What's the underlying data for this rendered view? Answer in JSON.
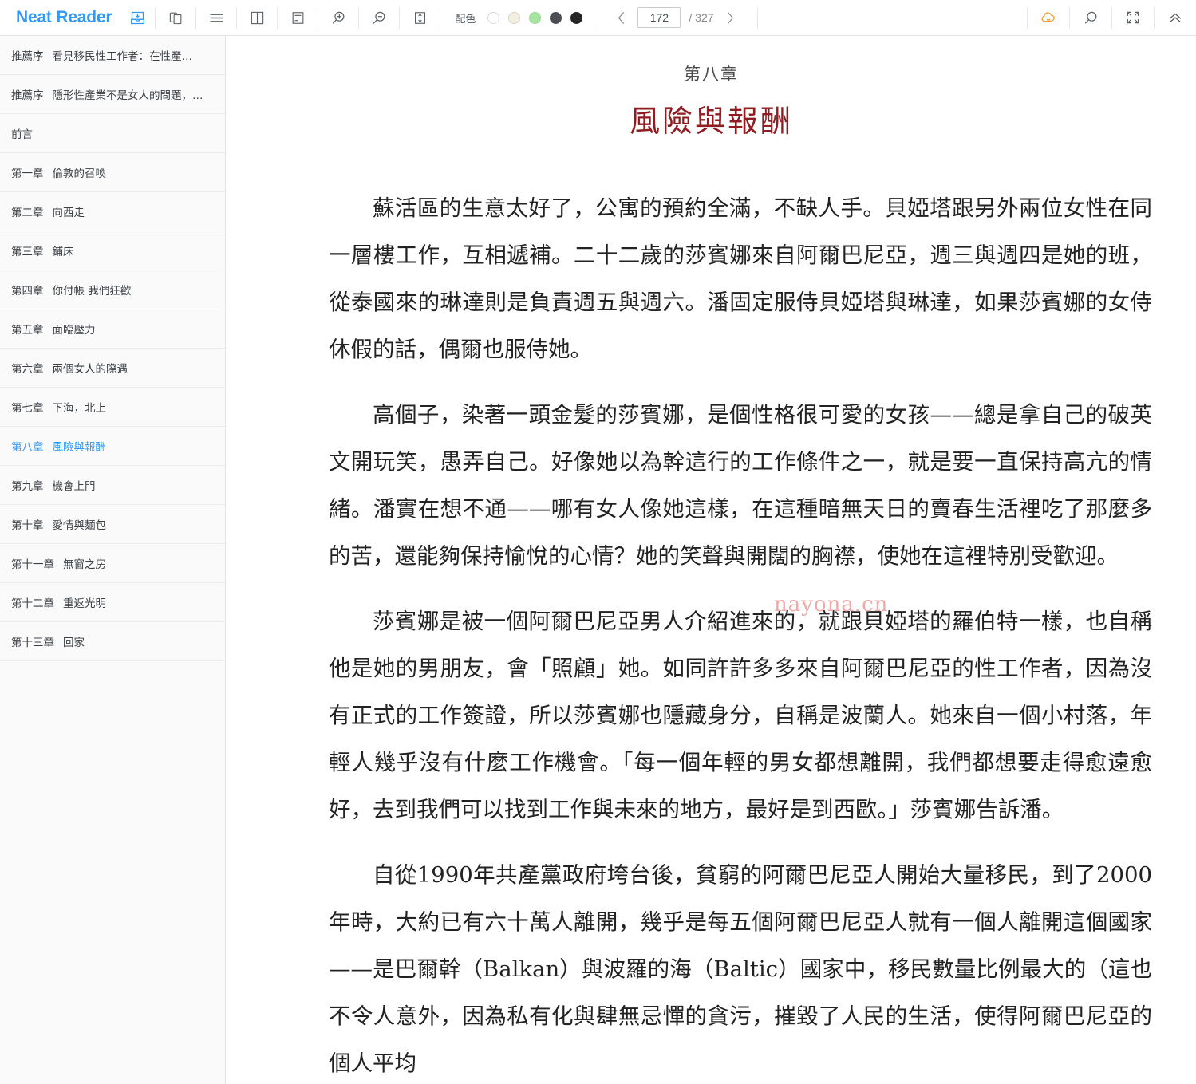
{
  "app": {
    "brand": "Neat Reader"
  },
  "toolbar": {
    "icons": [
      {
        "name": "save-to-shelf-icon",
        "title": "儲存"
      },
      {
        "name": "book-pages-icon",
        "title": "雙頁"
      },
      {
        "name": "hamburger-menu-icon",
        "title": "目錄"
      },
      {
        "name": "grid-layout-icon",
        "title": "版面"
      },
      {
        "name": "note-list-icon",
        "title": "筆記"
      },
      {
        "name": "zoom-in-icon",
        "title": "放大"
      },
      {
        "name": "zoom-out-icon",
        "title": "縮小"
      },
      {
        "name": "line-height-icon",
        "title": "行距"
      }
    ],
    "scheme": {
      "label": "配色",
      "swatches": [
        {
          "name": "scheme-white",
          "color": "#ffffff",
          "border": "#d8dade",
          "selected": false
        },
        {
          "name": "scheme-sepia",
          "color": "#f3efe0",
          "border": "#d8d4c3",
          "selected": false
        },
        {
          "name": "scheme-green",
          "color": "#a6e2a1",
          "border": "#92d28d",
          "selected": false
        },
        {
          "name": "scheme-gray",
          "color": "#4a4e52",
          "border": "#4a4e52",
          "selected": false
        },
        {
          "name": "scheme-black",
          "color": "#262626",
          "border": "#262626",
          "selected": false
        }
      ]
    },
    "pager": {
      "prev": "‹",
      "next": "›",
      "current_page": "172",
      "total_label": "/ 327"
    },
    "right_icons": [
      {
        "name": "cloud-sync-icon",
        "title": "雲端同步",
        "color": "#f09a2e"
      },
      {
        "name": "search-icon",
        "title": "搜尋",
        "color": "#5a5f66"
      },
      {
        "name": "fullscreen-icon",
        "title": "全螢幕",
        "color": "#5a5f66"
      },
      {
        "name": "collapse-toolbar-icon",
        "title": "收合",
        "color": "#5a5f66"
      }
    ]
  },
  "sidebar": {
    "items": [
      {
        "num": "推薦序",
        "title": "看見移民性工作者：在性產…",
        "active": false
      },
      {
        "num": "推薦序",
        "title": "隱形性產業不是女人的問題，…",
        "active": false
      },
      {
        "num": "",
        "title": "前言",
        "active": false
      },
      {
        "num": "第一章",
        "title": "倫敦的召喚",
        "active": false
      },
      {
        "num": "第二章",
        "title": "向西走",
        "active": false
      },
      {
        "num": "第三章",
        "title": "鋪床",
        "active": false
      },
      {
        "num": "第四章",
        "title": "你付帳 我們狂歡",
        "active": false
      },
      {
        "num": "第五章",
        "title": "面臨壓力",
        "active": false
      },
      {
        "num": "第六章",
        "title": "兩個女人的際遇",
        "active": false
      },
      {
        "num": "第七章",
        "title": "下海，北上",
        "active": false
      },
      {
        "num": "第八章",
        "title": "風險與報酬",
        "active": true
      },
      {
        "num": "第九章",
        "title": "機會上門",
        "active": false
      },
      {
        "num": "第十章",
        "title": "愛情與麵包",
        "active": false
      },
      {
        "num": "第十一章",
        "title": "無窗之房",
        "active": false
      },
      {
        "num": "第十二章",
        "title": "重返光明",
        "active": false
      },
      {
        "num": "第十三章",
        "title": "回家",
        "active": false
      }
    ]
  },
  "reader": {
    "chapter_number": "第八章",
    "chapter_title": "風險與報酬",
    "watermark": "nayona.cn",
    "paragraphs": [
      "蘇活區的生意太好了，公寓的預約全滿，不缺人手。貝婭塔跟另外兩位女性在同一層樓工作，互相遞補。二十二歲的莎賓娜來自阿爾巴尼亞，週三與週四是她的班，從泰國來的琳達則是負責週五與週六。潘固定服侍貝婭塔與琳達，如果莎賓娜的女侍休假的話，偶爾也服侍她。",
      "高個子，染著一頭金髮的莎賓娜，是個性格很可愛的女孩——總是拿自己的破英文開玩笑，愚弄自己。好像她以為幹這行的工作條件之一，就是要一直保持高亢的情緒。潘實在想不通——哪有女人像她這樣，在這種暗無天日的賣春生活裡吃了那麼多的苦，還能夠保持愉悅的心情？她的笑聲與開闊的胸襟，使她在這裡特別受歡迎。",
      "莎賓娜是被一個阿爾巴尼亞男人介紹進來的，就跟貝婭塔的羅伯特一樣，也自稱他是她的男朋友，會「照顧」她。如同許許多多來自阿爾巴尼亞的性工作者，因為沒有正式的工作簽證，所以莎賓娜也隱藏身分，自稱是波蘭人。她來自一個小村落，年輕人幾乎沒有什麼工作機會。「每一個年輕的男女都想離開，我們都想要走得愈遠愈好，去到我們可以找到工作與未來的地方，最好是到西歐。」莎賓娜告訴潘。",
      "自從1990年共產黨政府垮台後，貧窮的阿爾巴尼亞人開始大量移民，到了2000年時，大約已有六十萬人離開，幾乎是每五個阿爾巴尼亞人就有一個人離開這個國家——是巴爾幹（Balkan）與波羅的海（Baltic）國家中，移民數量比例最大的（這也不令人意外，因為私有化與肆無忌憚的貪污，摧毀了人民的生活，使得阿爾巴尼亞的個人平均"
    ]
  },
  "colors": {
    "brand": "#3399f3",
    "chapter_title": "#8f1d22",
    "sidebar_bg": "#fafafa",
    "active_item": "#3399f3",
    "cloud_icon": "#f09a2e"
  }
}
